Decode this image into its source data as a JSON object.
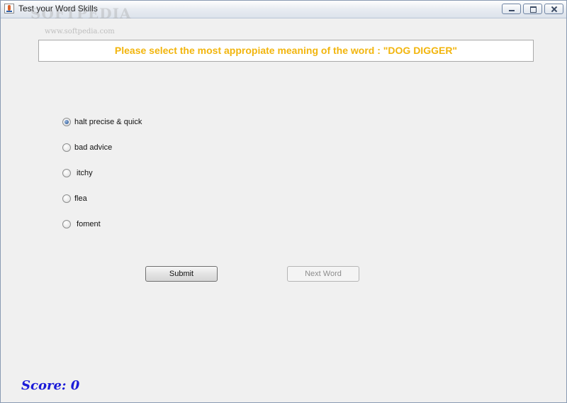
{
  "window": {
    "title": "Test your Word Skills",
    "watermark": "SOFTPEDIA",
    "watermark_url": "www.softpedia.com"
  },
  "question": {
    "text": "Please select the most appropiate meaning of the word : \"DOG DIGGER\""
  },
  "options": [
    {
      "label": "halt precise & quick",
      "selected": true
    },
    {
      "label": "bad advice",
      "selected": false
    },
    {
      "label": " itchy",
      "selected": false
    },
    {
      "label": "flea",
      "selected": false
    },
    {
      "label": " foment",
      "selected": false
    }
  ],
  "buttons": {
    "submit_label": "Submit",
    "next_label": "Next Word",
    "next_enabled": false
  },
  "score": {
    "text": "Score: 0"
  },
  "colors": {
    "question_text": "#f2b50d",
    "score_text": "#1b1bd8",
    "background": "#f0f0f0"
  }
}
